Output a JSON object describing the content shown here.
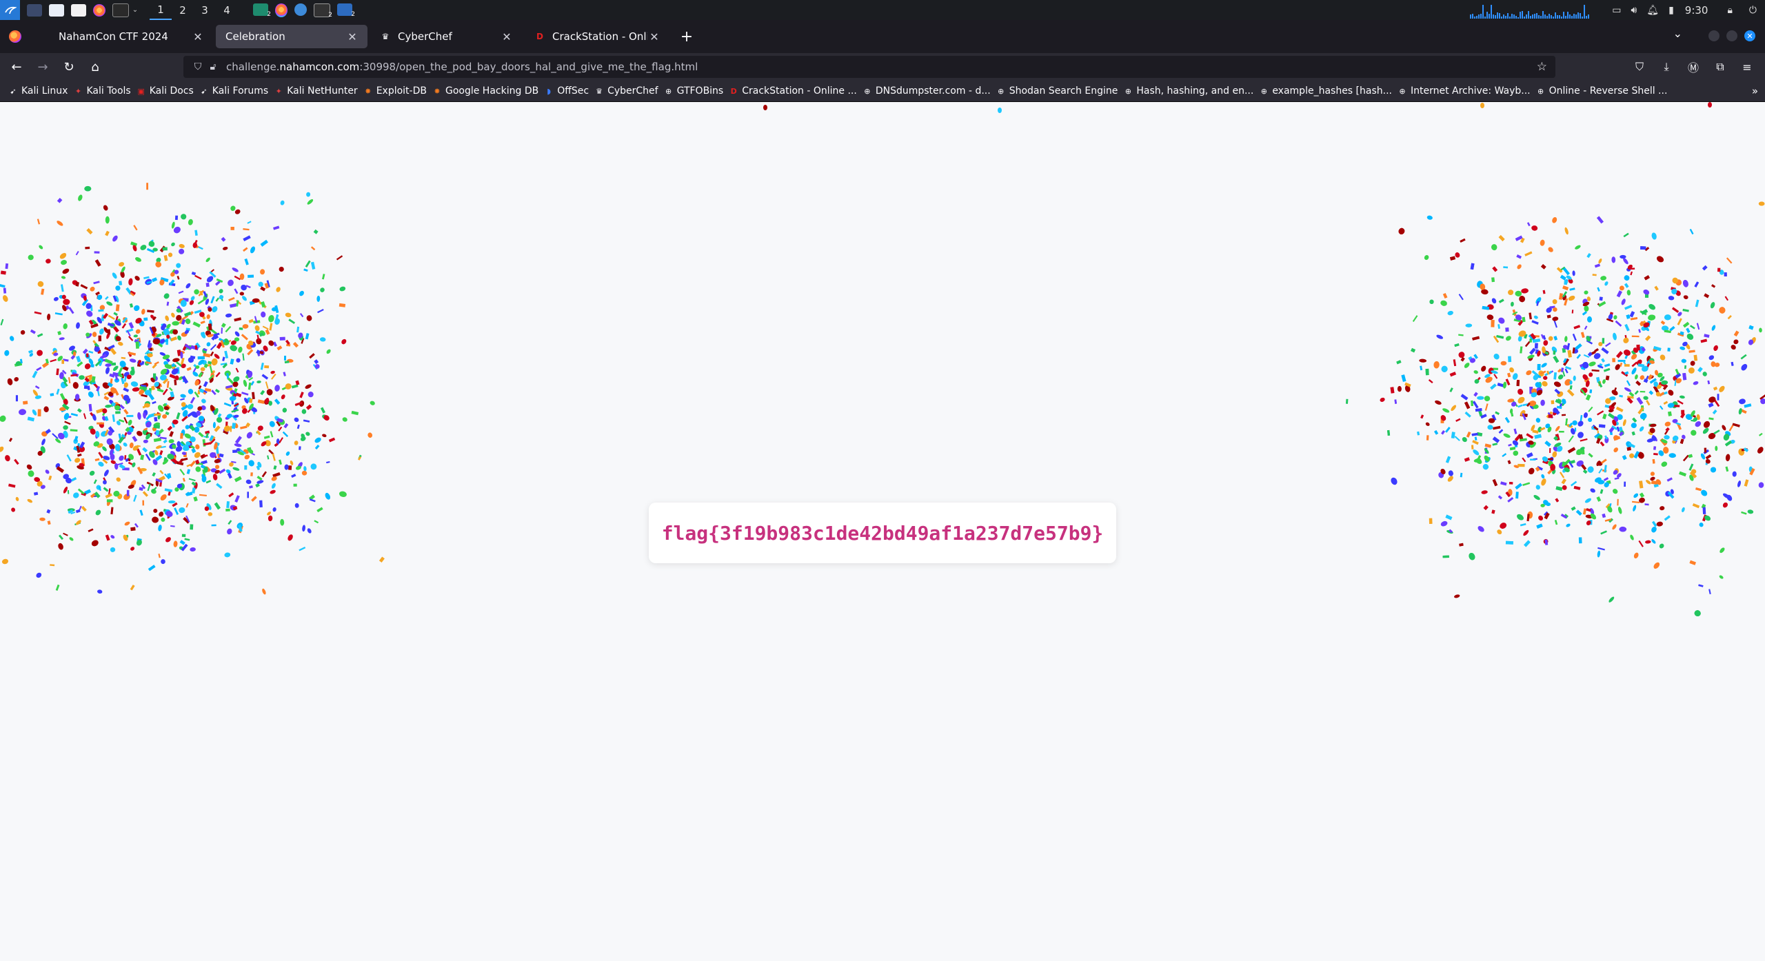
{
  "taskbar": {
    "workspaces": [
      "1",
      "2",
      "3",
      "4"
    ],
    "active_workspace": "1",
    "badges": [
      "2",
      "2",
      "2"
    ],
    "clock": "9:30"
  },
  "browser": {
    "tabs": [
      {
        "label": "NahamCon CTF 2024",
        "favicon": "firefox-icon",
        "active": false
      },
      {
        "label": "Celebration",
        "favicon": "",
        "active": true
      },
      {
        "label": "CyberChef",
        "favicon": "cyberchef-icon",
        "active": false
      },
      {
        "label": "CrackStation - Online Pas",
        "favicon": "crackstation-icon",
        "active": false
      }
    ],
    "url": {
      "prefix": "challenge.",
      "host": "nahamcon.com",
      "rest": ":30998/open_the_pod_bay_doors_hal_and_give_me_the_flag.html"
    },
    "bookmarks": [
      {
        "label": "Kali Linux",
        "icon": "kali-icon"
      },
      {
        "label": "Kali Tools",
        "icon": "kali-tools-icon"
      },
      {
        "label": "Kali Docs",
        "icon": "kali-docs-icon"
      },
      {
        "label": "Kali Forums",
        "icon": "kali-forums-icon"
      },
      {
        "label": "Kali NetHunter",
        "icon": "nethunter-icon"
      },
      {
        "label": "Exploit-DB",
        "icon": "exploit-db-icon"
      },
      {
        "label": "Google Hacking DB",
        "icon": "ghdb-icon"
      },
      {
        "label": "OffSec",
        "icon": "offsec-icon"
      },
      {
        "label": "CyberChef",
        "icon": "cyberchef-icon"
      },
      {
        "label": "GTFOBins",
        "icon": "globe-icon"
      },
      {
        "label": "CrackStation - Online ...",
        "icon": "crackstation-icon"
      },
      {
        "label": "DNSdumpster.com - d...",
        "icon": "globe-icon"
      },
      {
        "label": "Shodan Search Engine",
        "icon": "globe-icon"
      },
      {
        "label": "Hash, hashing, and en...",
        "icon": "globe-icon"
      },
      {
        "label": "example_hashes [hash...",
        "icon": "globe-icon"
      },
      {
        "label": "Internet Archive: Wayb...",
        "icon": "globe-icon"
      },
      {
        "label": "Online - Reverse Shell ...",
        "icon": "globe-icon"
      }
    ]
  },
  "page": {
    "flag": "flag{3f19b983c1de42bd49af1a237d7e57b9}",
    "confetti_colors": [
      "#d0021b",
      "#a40000",
      "#ff7f27",
      "#f5a623",
      "#3ad44a",
      "#22c55e",
      "#1ec8ff",
      "#00b7ff",
      "#3b3bff",
      "#6b3cff"
    ]
  },
  "colors": {
    "flag_text": "#c7317e",
    "page_background": "#f7f8fa",
    "accent": "#1e90ff"
  }
}
